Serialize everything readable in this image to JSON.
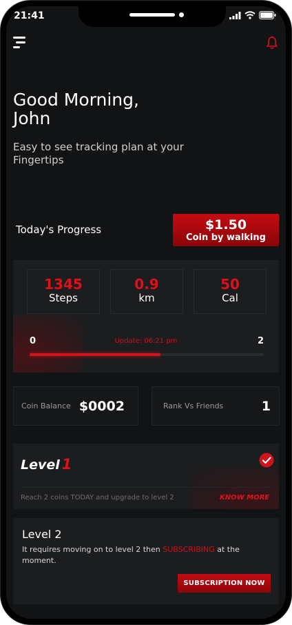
{
  "status_bar": {
    "time": "21:41"
  },
  "header": {
    "greeting": "Good Morning,\nJohn",
    "subtitle": "Easy to see tracking plan at your Fingertips"
  },
  "progress": {
    "title": "Today's Progress",
    "coin_amount": "$1.50",
    "coin_label": "Coin by walking"
  },
  "stats": [
    {
      "value": "1345",
      "label": "Steps"
    },
    {
      "value": "0.9",
      "label": "km"
    },
    {
      "value": "50",
      "label": "Cal"
    }
  ],
  "progress_bar": {
    "start": "0",
    "end": "2",
    "update_text": "Update: 06:21 pm",
    "fraction": 0.56
  },
  "coin_balance": {
    "label": "Coin Balance",
    "value": "$0002"
  },
  "rank": {
    "label": "Rank Vs Friends",
    "value": "1"
  },
  "level": {
    "title": "Level",
    "number": "1",
    "hint": "Reach 2 coins TODAY and upgrade to level 2",
    "link": "KNOW MORE"
  },
  "level2": {
    "title": "Level 2",
    "desc_pre": "It requires moving on to level 2 then ",
    "desc_highlight": "SUBSCRIBING",
    "desc_post": " at the moment.",
    "button": "SUBSCRIPTION NOW"
  },
  "colors": {
    "accent": "#d0141b",
    "background": "#121314",
    "card": "#1c1d1f"
  }
}
